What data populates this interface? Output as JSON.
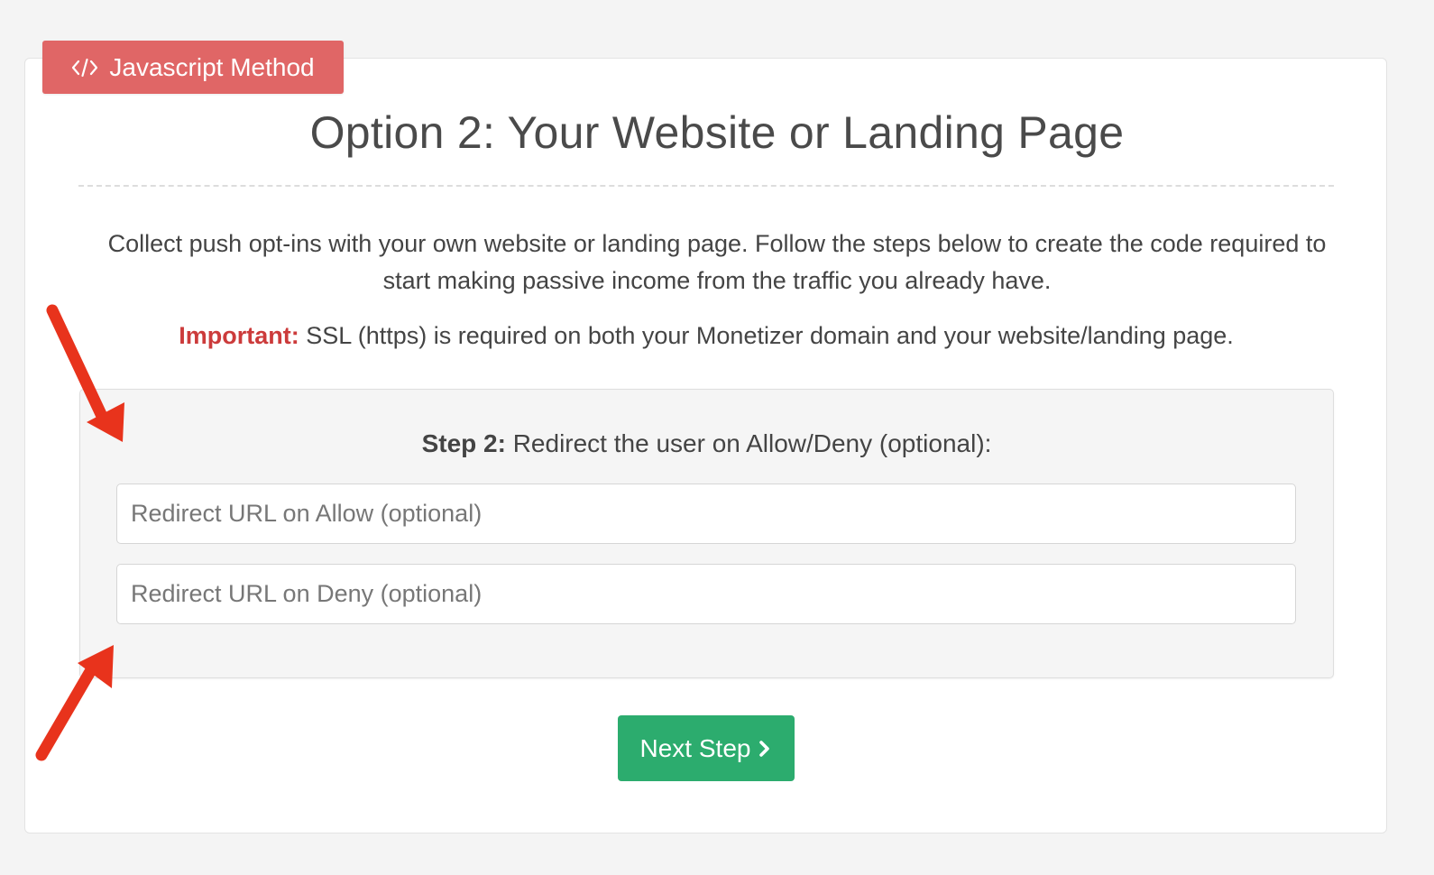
{
  "method_tab": {
    "label": "Javascript Method",
    "icon": "code-icon"
  },
  "title": "Option 2: Your Website or Landing Page",
  "description": "Collect push opt-ins with your own website or landing page. Follow the steps below to create the code required to start making passive income from the traffic you already have.",
  "important": {
    "label": "Important:",
    "text": " SSL (https) is required on both your Monetizer domain and your website/landing page."
  },
  "step": {
    "label": "Step 2:",
    "text": " Redirect the user on Allow/Deny (optional):",
    "allow_input": {
      "value": "",
      "placeholder": "Redirect URL on Allow (optional)"
    },
    "deny_input": {
      "value": "",
      "placeholder": "Redirect URL on Deny (optional)"
    }
  },
  "next_button": {
    "label": "Next Step",
    "icon": "chevron-right-icon"
  },
  "annotations": {
    "arrow_color": "#e8331c",
    "arrows": [
      "red-arrow-annotation",
      "red-arrow-annotation"
    ]
  },
  "colors": {
    "tab_red": "#e06666",
    "important_red": "#cc3b3b",
    "button_green": "#2cac6e"
  }
}
